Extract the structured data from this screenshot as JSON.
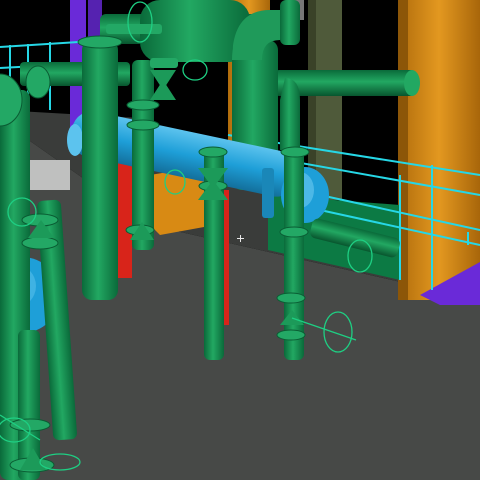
{
  "viewport": {
    "name": "3d-plant-model-viewport",
    "background": "#000000"
  },
  "colors": {
    "floor": "#4a4c4a",
    "floor_dark": "#3c3e3c",
    "pipe_green": "#0f8a4e",
    "pipe_green_dark": "#0a6a3a",
    "pipe_green_light": "#2bb56f",
    "pipe_blue": "#1e9fd8",
    "pipe_blue_light": "#5cc3ee",
    "railing_cyan": "#26d7e6",
    "steel_orange": "#d88a14",
    "steel_red": "#d8241a",
    "steel_purple": "#6a2ad8",
    "column_olive": "#4f5a3a",
    "wall_grey": "#bfc0bf",
    "handwheel": "#1ecf83"
  },
  "icons": {
    "crosshair": "crosshair-icon"
  }
}
